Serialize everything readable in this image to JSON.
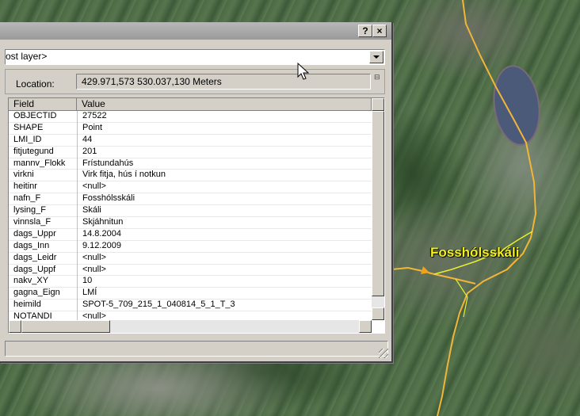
{
  "window": {
    "help_button": "?",
    "close_button": "×",
    "layer_select": "ost layer>",
    "location_label": "Location:",
    "location_value": "429.971,573  530.037,130 Meters"
  },
  "grid": {
    "columns": [
      "Field",
      "Value"
    ],
    "rows": [
      {
        "field": "OBJECTID",
        "value": "27522"
      },
      {
        "field": "SHAPE",
        "value": "Point"
      },
      {
        "field": "LMI_ID",
        "value": "44"
      },
      {
        "field": "fitjutegund",
        "value": "201"
      },
      {
        "field": "mannv_Flokk",
        "value": "Frístundahús"
      },
      {
        "field": "virkni",
        "value": "Virk fitja, hús í notkun"
      },
      {
        "field": "heitinr",
        "value": "<null>"
      },
      {
        "field": "nafn_F",
        "value": "Fosshólsskáli"
      },
      {
        "field": "lysing_F",
        "value": "Skáli"
      },
      {
        "field": "vinnsla_F",
        "value": "Skjáhnitun"
      },
      {
        "field": "dags_Uppr",
        "value": "14.8.2004"
      },
      {
        "field": "dags_Inn",
        "value": "9.12.2009"
      },
      {
        "field": "dags_Leidr",
        "value": "<null>"
      },
      {
        "field": "dags_Uppf",
        "value": "<null>"
      },
      {
        "field": "nakv_XY",
        "value": "10"
      },
      {
        "field": "gagna_Eign",
        "value": "LMÍ"
      },
      {
        "field": "heimild",
        "value": "SPOT-5_709_215_1_040814_5_1_T_3"
      },
      {
        "field": "NOTANDI",
        "value": "<null>"
      }
    ]
  },
  "map": {
    "place_label": "Fosshólsskáli",
    "road_color": "#f2b53a",
    "trail_color": "#e8ef2a"
  }
}
